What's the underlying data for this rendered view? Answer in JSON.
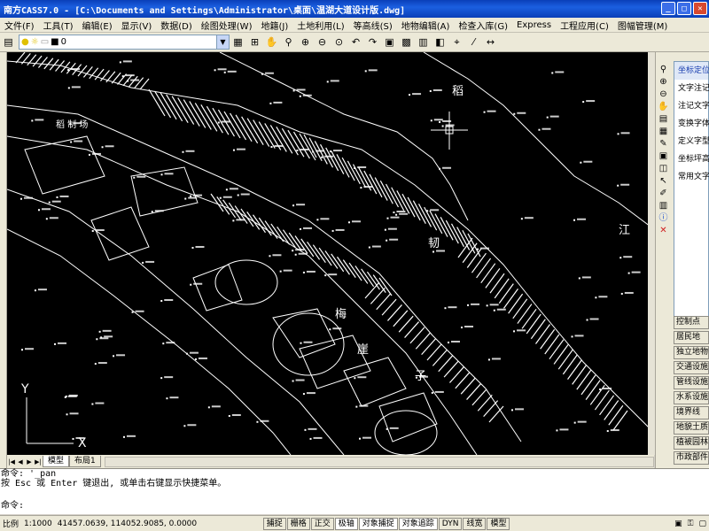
{
  "window": {
    "title": "南方CASS7.0 - [C:\\Documents and Settings\\Administrator\\桌面\\温湖大道设计版.dwg]"
  },
  "menu": [
    "文件(F)",
    "工具(T)",
    "编辑(E)",
    "显示(V)",
    "数据(D)",
    "绘图处理(W)",
    "地籍(J)",
    "土地利用(L)",
    "等高线(S)",
    "地物编辑(A)",
    "检查入库(G)",
    "Express",
    "工程应用(C)",
    "图幅管理(M)"
  ],
  "toolbar": {
    "layer_value": "0"
  },
  "drawing": {
    "labels": [
      "梅",
      "崖",
      "子",
      "江",
      "韧",
      "稻",
      "稻 制 场"
    ],
    "ucs_x": "X",
    "ucs_y": "Y"
  },
  "right_panel": {
    "items": [
      "坐标定位",
      "文字注记",
      "注记文字",
      "变换字体",
      "定义字型",
      "坐标坪高",
      "常用文字"
    ],
    "buttons": [
      "控制点",
      "居民地",
      "独立地物",
      "交通设施",
      "管线设施",
      "水系设施",
      "境界线",
      "地貌土质",
      "植被园林",
      "市政部件"
    ]
  },
  "tabs": {
    "model": "模型",
    "layout": "布局1"
  },
  "command": {
    "line1": "命令: '_pan",
    "line2": "按 Esc 或 Enter 键退出, 或单击右键显示快捷菜单。",
    "line3": "命令:"
  },
  "status": {
    "scale_prefix": "比例",
    "scale": "1:1000",
    "coords": "41457.0639, 114052.9085, 0.0000",
    "buttons": [
      "捕捉",
      "栅格",
      "正交",
      "极轴",
      "对象捕捉",
      "对象追踪",
      "DYN",
      "线宽",
      "模型"
    ]
  },
  "colors": {
    "titlebar": "#0a3fb8",
    "drawing_bg": "#000000",
    "linework": "#ffffff"
  }
}
